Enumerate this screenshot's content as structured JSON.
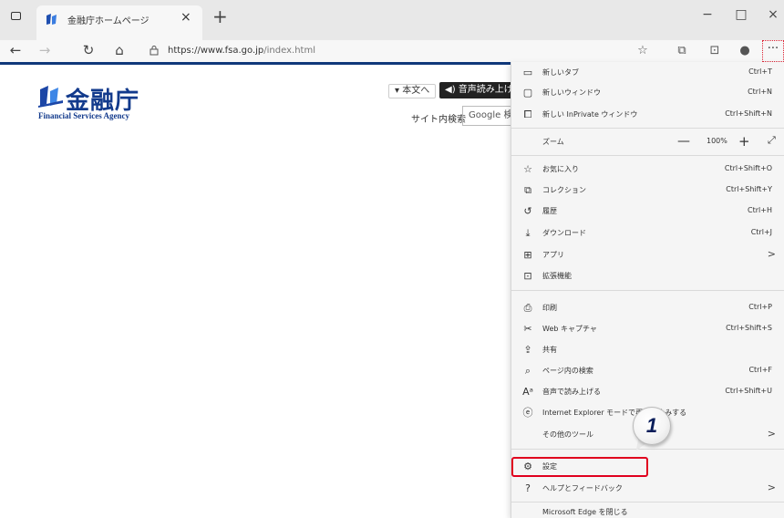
{
  "browser": {
    "tab": {
      "title": "金融庁ホームページ",
      "close": "×"
    },
    "new_tab": "+",
    "window": {
      "minimize": "−",
      "maximize": "□",
      "close": "×"
    },
    "nav": {
      "back": "←",
      "forward": "→",
      "refresh": "↻",
      "home": "⌂"
    },
    "url": {
      "host": "https://www.fsa.go.jp",
      "path": "/index.html"
    },
    "more_button": "···"
  },
  "page": {
    "logo_title": "金融庁",
    "logo_subtitle": "Financial Services Agency",
    "skip_link": "▾ 本文へ",
    "voice_button": "◀) 音声読み上げ",
    "site_search_label": "サイト内検索",
    "site_search_placeholder": "Google 検"
  },
  "menu": {
    "new_tab": {
      "label": "新しいタブ",
      "shortcut": "Ctrl+T"
    },
    "new_window": {
      "label": "新しいウィンドウ",
      "shortcut": "Ctrl+N"
    },
    "new_inprivate": {
      "label": "新しい InPrivate ウィンドウ",
      "shortcut": "Ctrl+Shift+N"
    },
    "zoom": {
      "label": "ズーム",
      "minus": "—",
      "value": "100%",
      "plus": "+",
      "fullscreen": "⤢"
    },
    "favorites": {
      "label": "お気に入り",
      "shortcut": "Ctrl+Shift+O"
    },
    "collections": {
      "label": "コレクション",
      "shortcut": "Ctrl+Shift+Y"
    },
    "history": {
      "label": "履歴",
      "shortcut": "Ctrl+H"
    },
    "downloads": {
      "label": "ダウンロード",
      "shortcut": "Ctrl+J"
    },
    "apps": {
      "label": "アプリ",
      "arrow": ">"
    },
    "extensions": {
      "label": "拡張機能"
    },
    "print": {
      "label": "印刷",
      "shortcut": "Ctrl+P"
    },
    "web_capture": {
      "label": "Web キャプチャ",
      "shortcut": "Ctrl+Shift+S"
    },
    "share": {
      "label": "共有"
    },
    "find": {
      "label": "ページ内の検索",
      "shortcut": "Ctrl+F"
    },
    "read_aloud": {
      "label": "音声で読み上げる",
      "shortcut": "Ctrl+Shift+U"
    },
    "ie_mode": {
      "label": "Internet Explorer モードで再読み込みする"
    },
    "more_tools": {
      "label": "その他のツール",
      "arrow": ">"
    },
    "settings": {
      "label": "設定"
    },
    "help": {
      "label": "ヘルプとフィードバック",
      "arrow": ">"
    },
    "close_edge": {
      "label": "Microsoft Edge を閉じる"
    }
  },
  "callout": {
    "number": "1"
  },
  "colors": {
    "highlight": "#e0001e",
    "brand_blue": "#123a8c"
  }
}
